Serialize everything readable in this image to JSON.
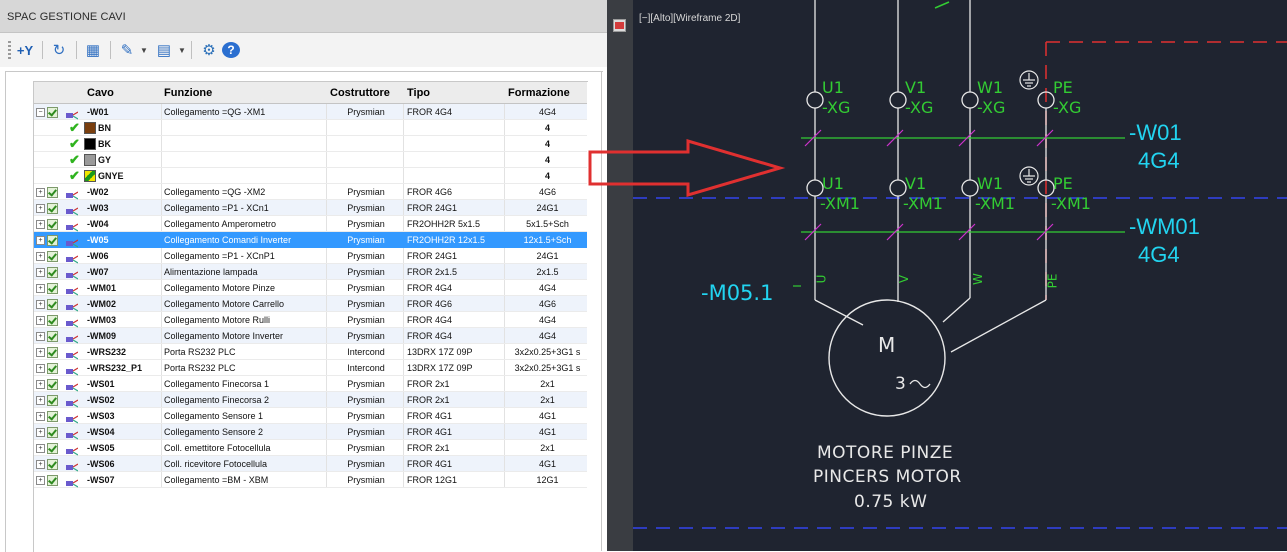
{
  "panel": {
    "title": "SPAC GESTIONE CAVI",
    "toolbar": [
      {
        "name": "add-cable-icon",
        "glyph": "+Y"
      },
      {
        "name": "refresh-cables-icon",
        "glyph": "↻"
      },
      {
        "name": "document-edit-icon",
        "glyph": "▦"
      },
      {
        "name": "edit-tool-icon",
        "glyph": "✎"
      },
      {
        "name": "export-dwg-icon",
        "glyph": "▤"
      },
      {
        "name": "settings-gear-icon",
        "glyph": "⚙"
      },
      {
        "name": "help-icon",
        "glyph": "?"
      }
    ]
  },
  "table": {
    "columns": [
      "Cavo",
      "Funzione",
      "Costruttore",
      "Tipo",
      "Formazione"
    ],
    "rows": [
      {
        "cavo": "-W01",
        "funzione": "Collegamento =QG -XM1",
        "costruttore": "Prysmian",
        "tipo": "FROR 4G4",
        "formazione": "4G4",
        "expanded": true,
        "band": true
      },
      {
        "conductor": true,
        "label": "BN",
        "color": "#7a3f0f",
        "formazione": "4"
      },
      {
        "conductor": true,
        "label": "BK",
        "color": "#000000",
        "formazione": "4"
      },
      {
        "conductor": true,
        "label": "GY",
        "color": "#9a9a9a",
        "formazione": "4"
      },
      {
        "conductor": true,
        "label": "GNYE",
        "color": "gnye",
        "formazione": "4"
      },
      {
        "cavo": "-W02",
        "funzione": "Collegamento =QG -XM2",
        "costruttore": "Prysmian",
        "tipo": "FROR 4G6",
        "formazione": "4G6"
      },
      {
        "cavo": "-W03",
        "funzione": "Collegamento =P1 - XCn1",
        "costruttore": "Prysmian",
        "tipo": "FROR 24G1",
        "formazione": "24G1",
        "band": true
      },
      {
        "cavo": "-W04",
        "funzione": "Collegamento Amperometro",
        "costruttore": "Prysmian",
        "tipo": "FR2OHH2R 5x1.5",
        "formazione": "5x1.5+Sch"
      },
      {
        "cavo": "-W05",
        "funzione": "Collegamento Comandi Inverter",
        "costruttore": "Prysmian",
        "tipo": "FR2OHH2R 12x1.5",
        "formazione": "12x1.5+Sch",
        "selected": true
      },
      {
        "cavo": "-W06",
        "funzione": "Collegamento =P1 - XCnP1",
        "costruttore": "Prysmian",
        "tipo": "FROR 24G1",
        "formazione": "24G1"
      },
      {
        "cavo": "-W07",
        "funzione": "Alimentazione lampada",
        "costruttore": "Prysmian",
        "tipo": "FROR 2x1.5",
        "formazione": "2x1.5",
        "band": true
      },
      {
        "cavo": "-WM01",
        "funzione": "Collegamento Motore Pinze",
        "costruttore": "Prysmian",
        "tipo": "FROR 4G4",
        "formazione": "4G4"
      },
      {
        "cavo": "-WM02",
        "funzione": "Collegamento Motore Carrello",
        "costruttore": "Prysmian",
        "tipo": "FROR 4G6",
        "formazione": "4G6",
        "band": true
      },
      {
        "cavo": "-WM03",
        "funzione": "Collegamento Motore Rulli",
        "costruttore": "Prysmian",
        "tipo": "FROR 4G4",
        "formazione": "4G4"
      },
      {
        "cavo": "-WM09",
        "funzione": "Collegamento Motore Inverter",
        "costruttore": "Prysmian",
        "tipo": "FROR 4G4",
        "formazione": "4G4",
        "band": true
      },
      {
        "cavo": "-WRS232",
        "funzione": "Porta RS232 PLC",
        "costruttore": "Intercond",
        "tipo": "13DRX 17Z 09P",
        "formazione": "3x2x0.25+3G1 s"
      },
      {
        "cavo": "-WRS232_P1",
        "funzione": "Porta RS232 PLC",
        "costruttore": "Intercond",
        "tipo": "13DRX 17Z 09P",
        "formazione": "3x2x0.25+3G1 s"
      },
      {
        "cavo": "-WS01",
        "funzione": "Collegamento Finecorsa 1",
        "costruttore": "Prysmian",
        "tipo": "FROR 2x1",
        "formazione": "2x1"
      },
      {
        "cavo": "-WS02",
        "funzione": "Collegamento Finecorsa 2",
        "costruttore": "Prysmian",
        "tipo": "FROR 2x1",
        "formazione": "2x1",
        "band": true
      },
      {
        "cavo": "-WS03",
        "funzione": "Collegamento Sensore 1",
        "costruttore": "Prysmian",
        "tipo": "FROR 4G1",
        "formazione": "4G1"
      },
      {
        "cavo": "-WS04",
        "funzione": "Collegamento Sensore 2",
        "costruttore": "Prysmian",
        "tipo": "FROR 4G1",
        "formazione": "4G1",
        "band": true
      },
      {
        "cavo": "-WS05",
        "funzione": "Coll. emettitore Fotocellula",
        "costruttore": "Prysmian",
        "tipo": "FROR 2x1",
        "formazione": "2x1"
      },
      {
        "cavo": "-WS06",
        "funzione": "Coll. ricevitore Fotocellula",
        "costruttore": "Prysmian",
        "tipo": "FROR 4G1",
        "formazione": "4G1",
        "band": true
      },
      {
        "cavo": "-WS07",
        "funzione": "Collegamento =BM - XBM",
        "costruttore": "Prysmian",
        "tipo": "FROR 12G1",
        "formazione": "12G1"
      }
    ]
  },
  "cad": {
    "viewport_label": "[−][Alto][Wireframe 2D]",
    "terminals_top": [
      "U1",
      "V1",
      "W1",
      "PE"
    ],
    "terminals_top_sub": [
      "-XG",
      "-XG",
      "-XG",
      "-XG"
    ],
    "terminals_bottom": [
      "U1",
      "V1",
      "W1",
      "PE"
    ],
    "terminals_bottom_sub": [
      "-XM1",
      "-XM1",
      "-XM1",
      "-XM1"
    ],
    "cable1_name": "-W01",
    "cable1_type": "4G4",
    "cable2_name": "-WM01",
    "cable2_type": "4G4",
    "motor_tag": "-M05.1",
    "motor_pins": [
      "U",
      "V",
      "W",
      "PE"
    ],
    "motor_letter": "M",
    "motor_phase": "3",
    "motor_desc_it": "MOTORE PINZE",
    "motor_desc_en": "PINCERS MOTOR",
    "motor_power": "0.75 kW",
    "colors": {
      "green": "#33cc33",
      "cyan": "#22d4f0",
      "magenta": "#cc33cc",
      "red": "#e03030",
      "blue": "#3344ee",
      "white": "#e8e8e8"
    }
  }
}
